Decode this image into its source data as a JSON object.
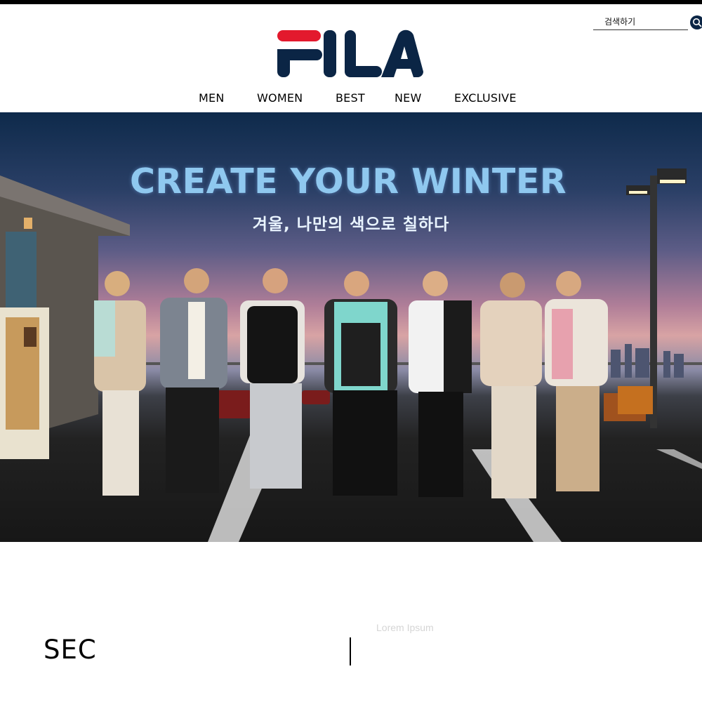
{
  "header": {
    "search": {
      "placeholder": "검색하기"
    },
    "logo": {
      "text": "FILA",
      "colors": {
        "red": "#e3192d",
        "navy": "#0b2545"
      }
    }
  },
  "nav": {
    "items": [
      {
        "label": "MEN"
      },
      {
        "label": "WOMEN"
      },
      {
        "label": "BEST"
      },
      {
        "label": "NEW"
      },
      {
        "label": "EXCLUSIVE"
      }
    ]
  },
  "hero": {
    "headline": "CREATE YOUR WINTER",
    "subheadline": "겨울, 나만의 색으로 칠하다",
    "image_description": "seven models in winter jackets on rooftop parking lot at dusk"
  },
  "section": {
    "title": "SEC",
    "lorem": "Lorem Ipsum"
  },
  "colors": {
    "accent_navy": "#0b2545",
    "accent_red": "#e3192d",
    "headline_blue": "#8fc8ef"
  }
}
